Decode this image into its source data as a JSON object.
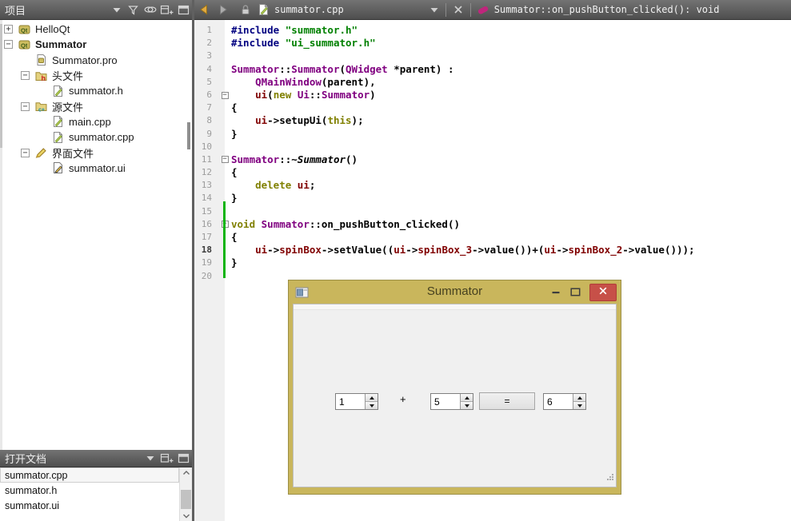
{
  "colors": {
    "accent_gold": "#c9b65c",
    "close_red": "#c75048",
    "header_dark": "#4e4e4e",
    "preprocessor": "#000080",
    "string": "#008000",
    "type": "#800080",
    "keyword": "#808000",
    "field": "#800000",
    "change_bar": "#0cb40c"
  },
  "project_panel": {
    "title": "项目",
    "tree": [
      {
        "label": "HelloQt",
        "expander": "+",
        "icon": "qt-project-icon",
        "indent": 0,
        "bold": false
      },
      {
        "label": "Summator",
        "expander": "-",
        "icon": "qt-project-icon",
        "indent": 0,
        "bold": true
      },
      {
        "label": "Summator.pro",
        "expander": "",
        "icon": "pro-file-icon",
        "indent": 1,
        "bold": false
      },
      {
        "label": "头文件",
        "expander": "-",
        "icon": "header-folder-icon",
        "indent": 1,
        "bold": false
      },
      {
        "label": "summator.h",
        "expander": "",
        "icon": "source-file-icon",
        "indent": 2,
        "bold": false
      },
      {
        "label": "源文件",
        "expander": "-",
        "icon": "source-folder-icon",
        "indent": 1,
        "bold": false
      },
      {
        "label": "main.cpp",
        "expander": "",
        "icon": "source-file-icon",
        "indent": 2,
        "bold": false
      },
      {
        "label": "summator.cpp",
        "expander": "",
        "icon": "source-file-icon",
        "indent": 2,
        "bold": false
      },
      {
        "label": "界面文件",
        "expander": "-",
        "icon": "ui-folder-icon",
        "indent": 1,
        "bold": false
      },
      {
        "label": "summator.ui",
        "expander": "",
        "icon": "ui-file-icon",
        "indent": 2,
        "bold": false
      }
    ]
  },
  "open_documents": {
    "title": "打开文档",
    "items": [
      {
        "label": "summator.cpp",
        "selected": true
      },
      {
        "label": "summator.h",
        "selected": false
      },
      {
        "label": "summator.ui",
        "selected": false
      }
    ]
  },
  "editor_toolbar": {
    "file_name": "summator.cpp",
    "symbol": "Summator::on_pushButton_clicked(): void"
  },
  "code": {
    "lines": [
      {
        "fold": false,
        "cur": false,
        "tokens": [
          [
            "pp",
            "#include"
          ],
          [
            "plain",
            " "
          ],
          [
            "str",
            "\"summator.h\""
          ]
        ]
      },
      {
        "fold": false,
        "cur": false,
        "tokens": [
          [
            "pp",
            "#include"
          ],
          [
            "plain",
            " "
          ],
          [
            "str",
            "\"ui_summator.h\""
          ]
        ]
      },
      {
        "fold": false,
        "cur": false,
        "tokens": []
      },
      {
        "fold": false,
        "cur": false,
        "tokens": [
          [
            "type",
            "Summator"
          ],
          [
            "plain",
            "::"
          ],
          [
            "type",
            "Summator"
          ],
          [
            "plain",
            "("
          ],
          [
            "type",
            "QWidget"
          ],
          [
            "plain",
            " *parent) :"
          ]
        ]
      },
      {
        "fold": false,
        "cur": false,
        "tokens": [
          [
            "plain",
            "    "
          ],
          [
            "type",
            "QMainWindow"
          ],
          [
            "plain",
            "(parent),"
          ]
        ]
      },
      {
        "fold": true,
        "cur": false,
        "tokens": [
          [
            "plain",
            "    "
          ],
          [
            "field",
            "ui"
          ],
          [
            "plain",
            "("
          ],
          [
            "kw",
            "new"
          ],
          [
            "plain",
            " "
          ],
          [
            "type",
            "Ui"
          ],
          [
            "plain",
            "::"
          ],
          [
            "type",
            "Summator"
          ],
          [
            "plain",
            ")"
          ]
        ]
      },
      {
        "fold": false,
        "cur": false,
        "tokens": [
          [
            "plain",
            "{"
          ]
        ]
      },
      {
        "fold": false,
        "cur": false,
        "tokens": [
          [
            "plain",
            "    "
          ],
          [
            "field",
            "ui"
          ],
          [
            "plain",
            "->setupUi("
          ],
          [
            "kw",
            "this"
          ],
          [
            "plain",
            ");"
          ]
        ]
      },
      {
        "fold": false,
        "cur": false,
        "tokens": [
          [
            "plain",
            "}"
          ]
        ]
      },
      {
        "fold": false,
        "cur": false,
        "tokens": []
      },
      {
        "fold": true,
        "cur": false,
        "tokens": [
          [
            "type",
            "Summator"
          ],
          [
            "plain",
            "::"
          ],
          [
            "it",
            "~Summator"
          ],
          [
            "plain",
            "()"
          ]
        ]
      },
      {
        "fold": false,
        "cur": false,
        "tokens": [
          [
            "plain",
            "{"
          ]
        ]
      },
      {
        "fold": false,
        "cur": false,
        "tokens": [
          [
            "plain",
            "    "
          ],
          [
            "kw",
            "delete"
          ],
          [
            "plain",
            " "
          ],
          [
            "field",
            "ui"
          ],
          [
            "plain",
            ";"
          ]
        ]
      },
      {
        "fold": false,
        "cur": false,
        "tokens": [
          [
            "plain",
            "}"
          ]
        ]
      },
      {
        "fold": false,
        "cur": false,
        "tokens": []
      },
      {
        "fold": true,
        "cur": false,
        "tokens": [
          [
            "kw",
            "void"
          ],
          [
            "plain",
            " "
          ],
          [
            "type",
            "Summator"
          ],
          [
            "plain",
            "::on_pushButton_clicked()"
          ]
        ]
      },
      {
        "fold": false,
        "cur": false,
        "tokens": [
          [
            "plain",
            "{"
          ]
        ]
      },
      {
        "fold": false,
        "cur": true,
        "tokens": [
          [
            "plain",
            "    "
          ],
          [
            "field",
            "ui"
          ],
          [
            "plain",
            "->"
          ],
          [
            "field",
            "spinBox"
          ],
          [
            "plain",
            "->setValue(("
          ],
          [
            "field",
            "ui"
          ],
          [
            "plain",
            "->"
          ],
          [
            "field",
            "spinBox_3"
          ],
          [
            "plain",
            "->value())+("
          ],
          [
            "field",
            "ui"
          ],
          [
            "plain",
            "->"
          ],
          [
            "field",
            "spinBox_2"
          ],
          [
            "plain",
            "->value()));"
          ]
        ]
      },
      {
        "fold": false,
        "cur": false,
        "tokens": [
          [
            "plain",
            "}"
          ]
        ]
      },
      {
        "fold": false,
        "cur": false,
        "tokens": []
      }
    ]
  },
  "app_window": {
    "title": "Summator",
    "spinbox_left": "1",
    "operator": "+",
    "spinbox_mid": "5",
    "equals_button": "=",
    "spinbox_result": "6"
  }
}
